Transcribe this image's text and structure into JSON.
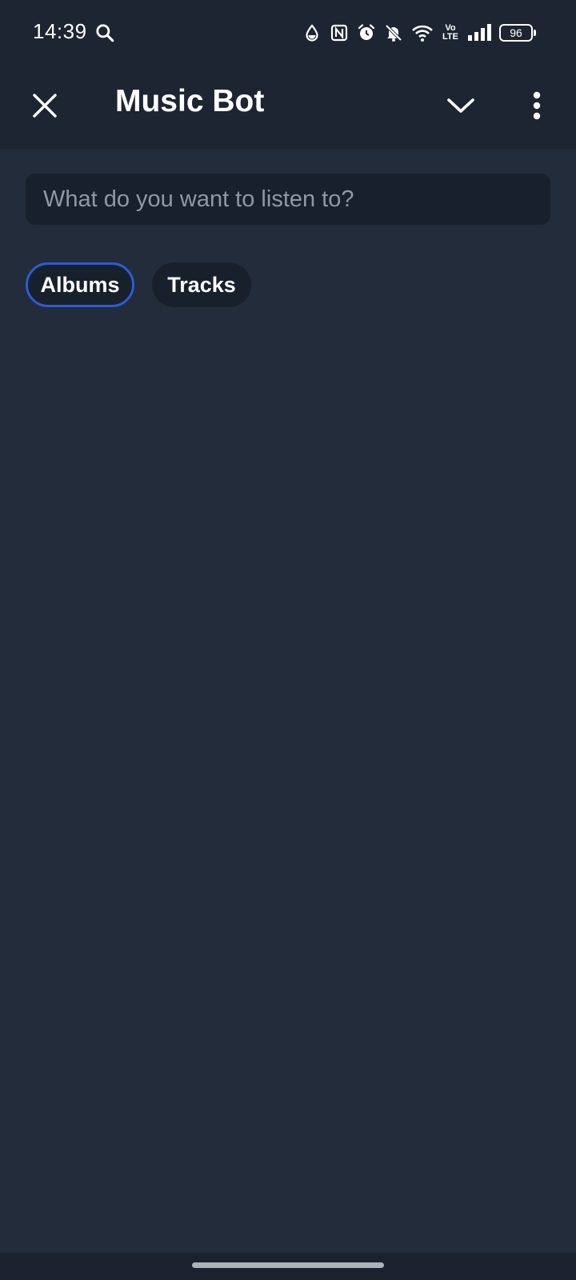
{
  "status_bar": {
    "time": "14:39",
    "battery": "96",
    "volte_line1": "Vo",
    "volte_line2": "LTE",
    "icons": [
      "search-icon",
      "drop-icon",
      "nfc-icon",
      "alarm-icon",
      "bell-off-icon",
      "wifi-icon",
      "volte-icon",
      "signal-icon",
      "battery-icon"
    ]
  },
  "app_bar": {
    "title": "Music Bot",
    "icons": [
      "close-icon",
      "chevron-down-icon",
      "more-vert-icon"
    ]
  },
  "search": {
    "placeholder": "What do you want to listen to?",
    "value": ""
  },
  "filters": {
    "chips": [
      {
        "label": "Albums",
        "selected": true
      },
      {
        "label": "Tracks",
        "selected": false
      }
    ]
  },
  "colors": {
    "background": "#222c3a",
    "bar": "#1d2532",
    "input_bg": "#18202b",
    "accent": "#2d5bd4",
    "placeholder": "#8f98a4"
  }
}
